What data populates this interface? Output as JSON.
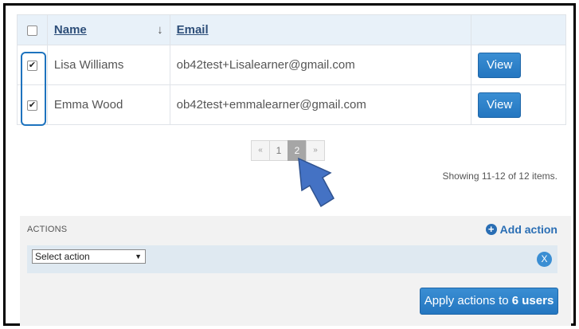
{
  "table": {
    "headers": {
      "name": "Name",
      "email": "Email",
      "sort_icon": "↓"
    },
    "rows": [
      {
        "name": "Lisa Williams",
        "email": "ob42test+Lisalearner@gmail.com",
        "checked": true,
        "view_label": "View"
      },
      {
        "name": "Emma Wood",
        "email": "ob42test+emmalearner@gmail.com",
        "checked": true,
        "view_label": "View"
      }
    ]
  },
  "pagination": {
    "prev": "«",
    "pages": [
      "1",
      "2"
    ],
    "current": "2",
    "next": "»"
  },
  "summary": "Showing 11-12 of 12 items.",
  "actions": {
    "label": "ACTIONS",
    "add_action_label": "Add action",
    "select_value": "Select action",
    "remove_label": "X",
    "apply_prefix": "Apply actions to",
    "apply_count": "6 users"
  },
  "colors": {
    "accent": "#2476c0",
    "highlight": "#1e73be",
    "header_bg": "#e8f1f9"
  }
}
